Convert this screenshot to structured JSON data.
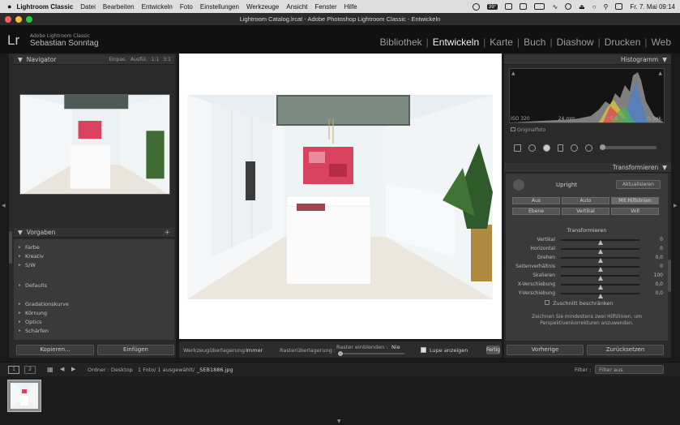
{
  "menubar": {
    "items": [
      "Lightroom Classic",
      "Datei",
      "Bearbeiten",
      "Entwickeln",
      "Foto",
      "Einstellungen",
      "Werkzeuge",
      "Ansicht",
      "Fenster",
      "Hilfe"
    ],
    "temperature": "39°",
    "datetime": "Fr. 7. Mai 09:14"
  },
  "window": {
    "title": "Lightroom Catalog.lrcat - Adobe Photoshop Lightroom Classic - Entwickeln"
  },
  "identity": {
    "logo": "Lr",
    "small": "Adobe Lightroom Classic",
    "name": "Sebastian Sonntag"
  },
  "modules": [
    "Bibliothek",
    "Entwickeln",
    "Karte",
    "Buch",
    "Diashow",
    "Drucken",
    "Web"
  ],
  "navigator": {
    "title": "Navigator",
    "options": [
      "Einpas.",
      "Ausfül.",
      "1:1",
      "3:1"
    ]
  },
  "presets": {
    "title": "Vorgaben",
    "group1": [
      "Farbe",
      "Kreativ",
      "S/W"
    ],
    "group2": [
      "Defaults"
    ],
    "group3": [
      "Gradationskurve",
      "Körnung",
      "Optics",
      "Schärfen"
    ]
  },
  "left_buttons": {
    "copy": "Kopieren...",
    "paste": "Einfügen"
  },
  "toolbar": {
    "tool_overlay": "Werkzeugüberlagerung :",
    "tool_overlay_value": "Immer",
    "raster_overlay": "Rasterüberlagerung :",
    "raster_show": "Raster einblenden :",
    "raster_show_value": "Nie",
    "loupe": "Lupe anzeigen",
    "done": "Fertig"
  },
  "histogram": {
    "title": "Histogramm",
    "iso": "ISO 320",
    "focal": "24 mm",
    "aperture": "f / 5,6",
    "shutter": "¹⁄₅ Sek.",
    "original": "Originalfoto"
  },
  "transform": {
    "title": "Transformieren",
    "upright": "Upright",
    "update": "Aktualisieren",
    "buttons_row1": [
      "Aus",
      "Auto",
      "Mit Hilfslinien"
    ],
    "buttons_row2": [
      "Ebene",
      "Vertikal",
      "Voll"
    ],
    "section": "Transformieren",
    "sliders": [
      {
        "label": "Vertikal",
        "value": "0",
        "pos": 0.5
      },
      {
        "label": "Horizontal",
        "value": "0",
        "pos": 0.5
      },
      {
        "label": "Drehen",
        "value": "0,0",
        "pos": 0.5
      },
      {
        "label": "Seitenverhältnis",
        "value": "0",
        "pos": 0.5
      },
      {
        "label": "Skalieren",
        "value": "100",
        "pos": 0.5
      },
      {
        "label": "X-Verschiebung",
        "value": "0,0",
        "pos": 0.5
      },
      {
        "label": "Y-Verschiebung",
        "value": "0,0",
        "pos": 0.5
      }
    ],
    "constrain": "Zuschnitt beschränken",
    "hint_line1": "Zeichnen Sie mindestens zwei Hilfslinien, um",
    "hint_line2": "Perspektivenkorrekturen anzuwenden."
  },
  "right_buttons": {
    "previous": "Vorherige",
    "reset": "Zurücksetzen"
  },
  "filmbar": {
    "pages": [
      "1",
      "2"
    ],
    "source": "Ordner : Desktop",
    "info": "1 Foto/ 1 ausgewählt/",
    "file": "_SEB1886.jpg",
    "filter_label": "Filter :",
    "filter_value": "Filter aus"
  },
  "colors": {
    "accent_art": "#d9435f",
    "panel": "#2a2a2a",
    "background": "#1a1a1a"
  }
}
